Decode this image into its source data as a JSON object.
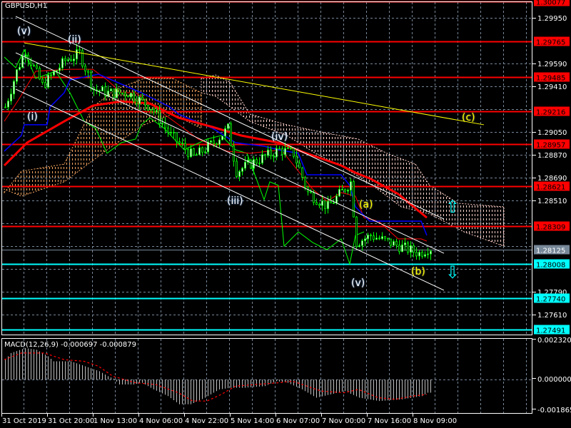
{
  "chart_data": {
    "type": "candlestick",
    "symbol_label": "GBPUSD,H1",
    "price_range": [
      1.2743,
      1.30091
    ],
    "price_ticks": [
      "1.29950",
      "1.29590",
      "1.29410",
      "1.29050",
      "1.28870",
      "1.28690",
      "1.28510",
      "1.27790",
      "1.27610"
    ],
    "time_labels": [
      "31 Oct 2019",
      "31 Oct 20:00",
      "1 Nov 13:00",
      "4 Nov 06:00",
      "4 Nov 22:00",
      "5 Nov 14:00",
      "6 Nov 07:00",
      "7 Nov 00:00",
      "7 Nov 16:00",
      "8 Nov 09:00"
    ],
    "bars": 150,
    "close_path": [
      [
        0,
        1.29247
      ],
      [
        4,
        1.29528
      ],
      [
        7,
        1.29697
      ],
      [
        13,
        1.29416
      ],
      [
        21,
        1.29613
      ],
      [
        26,
        1.29669
      ],
      [
        31,
        1.29387
      ],
      [
        36,
        1.29359
      ],
      [
        43,
        1.29359
      ],
      [
        51,
        1.29247
      ],
      [
        58,
        1.29022
      ],
      [
        66,
        1.28853
      ],
      [
        73,
        1.28966
      ],
      [
        78,
        1.29078
      ],
      [
        81,
        1.28741
      ],
      [
        88,
        1.28825
      ],
      [
        96,
        1.28909
      ],
      [
        101,
        1.28881
      ],
      [
        106,
        1.28572
      ],
      [
        113,
        1.28459
      ],
      [
        121,
        1.28656
      ],
      [
        123,
        1.28178
      ],
      [
        128,
        1.28234
      ],
      [
        138,
        1.2815
      ],
      [
        145,
        1.28094
      ],
      [
        148,
        1.28133
      ]
    ],
    "levels": [
      {
        "price": 1.30077,
        "label": "1.30077",
        "color": "#ff0000"
      },
      {
        "price": 1.29765,
        "label": "1.29765",
        "color": "#ff0000"
      },
      {
        "price": 1.29485,
        "label": "1.29485",
        "color": "#ff0000"
      },
      {
        "price": 1.29216,
        "label": "1.29216",
        "color": "#ff0000"
      },
      {
        "price": 1.28957,
        "label": "1.28957",
        "color": "#ff0000"
      },
      {
        "price": 1.28621,
        "label": "1.28621",
        "color": "#ff0000"
      },
      {
        "price": 1.28309,
        "label": "1.28309",
        "color": "#ff0000"
      },
      {
        "price": 1.28008,
        "label": "1.28008",
        "color": "#00ffff"
      },
      {
        "price": 1.2774,
        "label": "1.27740",
        "color": "#00ffff"
      },
      {
        "price": 1.27491,
        "label": "1.27491",
        "color": "#00ffff"
      }
    ],
    "current_price": {
      "price": 1.28125,
      "label": "1.28125",
      "color": "#778899"
    },
    "ma_red": [
      [
        0,
        1.28786
      ],
      [
        8,
        1.28966
      ],
      [
        21,
        1.29134
      ],
      [
        31,
        1.29258
      ],
      [
        41,
        1.29292
      ],
      [
        51,
        1.29275
      ],
      [
        61,
        1.29163
      ],
      [
        73,
        1.29089
      ],
      [
        83,
        1.29022
      ],
      [
        96,
        1.28966
      ],
      [
        106,
        1.28881
      ],
      [
        118,
        1.28786
      ],
      [
        123,
        1.28729
      ],
      [
        128,
        1.28684
      ],
      [
        138,
        1.28561
      ],
      [
        148,
        1.28375
      ]
    ],
    "tenkan_blue": [
      [
        0,
        1.28899
      ],
      [
        6,
        1.29022
      ],
      [
        7,
        1.29107
      ],
      [
        15,
        1.29107
      ],
      [
        16,
        1.29247
      ],
      [
        21,
        1.2936
      ],
      [
        23,
        1.29461
      ],
      [
        33,
        1.29506
      ],
      [
        48,
        1.2936
      ],
      [
        58,
        1.29247
      ],
      [
        61,
        1.29191
      ],
      [
        73,
        1.29079
      ],
      [
        81,
        1.28966
      ],
      [
        91,
        1.28938
      ],
      [
        96,
        1.2891
      ],
      [
        103,
        1.28882
      ],
      [
        106,
        1.28713
      ],
      [
        118,
        1.28713
      ],
      [
        121,
        1.28629
      ],
      [
        123,
        1.2846
      ],
      [
        128,
        1.28347
      ],
      [
        146,
        1.28347
      ],
      [
        148,
        1.28235
      ]
    ],
    "kijun_red": [
      [
        0,
        1.29135
      ],
      [
        5,
        1.29304
      ],
      [
        11,
        1.29529
      ],
      [
        23,
        1.29545
      ],
      [
        31,
        1.29545
      ],
      [
        36,
        1.29461
      ],
      [
        41,
        1.2936
      ],
      [
        46,
        1.2936
      ],
      [
        56,
        1.29191
      ],
      [
        68,
        1.28994
      ],
      [
        78,
        1.28899
      ],
      [
        86,
        1.28882
      ],
      [
        97,
        1.2891
      ],
      [
        103,
        1.28741
      ],
      [
        108,
        1.286
      ],
      [
        113,
        1.28505
      ],
      [
        118,
        1.28572
      ],
      [
        123,
        1.28544
      ],
      [
        126,
        1.28375
      ],
      [
        131,
        1.28347
      ],
      [
        138,
        1.28207
      ],
      [
        146,
        1.28207
      ],
      [
        148,
        1.2819
      ]
    ],
    "chikou_green": [
      [
        0,
        1.29641
      ],
      [
        4,
        1.29557
      ],
      [
        7,
        1.29697
      ],
      [
        11,
        1.29472
      ],
      [
        18,
        1.29529
      ],
      [
        23,
        1.2936
      ],
      [
        28,
        1.29135
      ],
      [
        32,
        1.29079
      ],
      [
        36,
        1.28882
      ],
      [
        41,
        1.28966
      ],
      [
        46,
        1.28994
      ],
      [
        48,
        1.29107
      ],
      [
        51,
        1.29163
      ],
      [
        56,
        1.29079
      ],
      [
        63,
        1.2891
      ],
      [
        71,
        1.28994
      ],
      [
        76,
        1.29022
      ],
      [
        81,
        1.2891
      ],
      [
        85,
        1.28882
      ],
      [
        91,
        1.28516
      ],
      [
        93,
        1.28657
      ],
      [
        96,
        1.28629
      ],
      [
        98,
        1.2815
      ],
      [
        103,
        1.28263
      ],
      [
        108,
        1.28179
      ],
      [
        113,
        1.28122
      ],
      [
        118,
        1.28207
      ],
      [
        121,
        1.2801
      ],
      [
        123,
        1.28235
      ],
      [
        126,
        1.28263
      ]
    ],
    "cloud_orange": {
      "top": [
        [
          0,
          1.28572
        ],
        [
          6,
          1.28741
        ],
        [
          21,
          1.28797
        ],
        [
          26,
          1.29022
        ],
        [
          31,
          1.29247
        ],
        [
          39,
          1.29388
        ],
        [
          49,
          1.29472
        ],
        [
          59,
          1.29472
        ],
        [
          69,
          1.2936
        ]
      ],
      "bottom": [
        [
          0,
          1.286
        ],
        [
          6,
          1.28544
        ],
        [
          21,
          1.28657
        ],
        [
          26,
          1.28741
        ],
        [
          36,
          1.2891
        ],
        [
          49,
          1.29107
        ],
        [
          59,
          1.29191
        ],
        [
          69,
          1.29079
        ]
      ],
      "color": "#f4a460"
    },
    "cloud_pink": {
      "top": [
        [
          69,
          1.29472
        ],
        [
          74,
          1.295
        ],
        [
          79,
          1.29444
        ],
        [
          86,
          1.29191
        ],
        [
          99,
          1.29107
        ],
        [
          111,
          1.2905
        ],
        [
          124,
          1.28994
        ],
        [
          134,
          1.28882
        ],
        [
          144,
          1.28797
        ],
        [
          149,
          1.28629
        ],
        [
          159,
          1.28488
        ],
        [
          175,
          1.2846
        ]
      ],
      "bottom": [
        [
          69,
          1.2936
        ],
        [
          74,
          1.29332
        ],
        [
          86,
          1.29135
        ],
        [
          99,
          1.29022
        ],
        [
          109,
          1.28882
        ],
        [
          119,
          1.28769
        ],
        [
          129,
          1.28629
        ],
        [
          139,
          1.2846
        ],
        [
          149,
          1.28404
        ],
        [
          161,
          1.28263
        ],
        [
          175,
          1.2815
        ]
      ],
      "color": "#ffd0c8"
    },
    "channel_lines": [
      {
        "from": [
          4,
          1.29962
        ],
        "to": [
          154,
          1.28364
        ]
      },
      {
        "from": [
          4,
          1.29675
        ],
        "to": [
          154,
          1.28094
        ]
      },
      {
        "from": [
          4,
          1.29388
        ],
        "to": [
          154,
          1.27802
        ]
      }
    ],
    "trend_line_yellow": {
      "from": [
        7,
        1.29753
      ],
      "to": [
        168,
        1.29107
      ]
    },
    "wave_labels": [
      "(v)",
      "(ii)",
      "(i)",
      "(iii)",
      "(iv)",
      "(a)",
      "(b)",
      "(v)",
      "(c)"
    ],
    "macd": {
      "title": "MACD(12,26,9) -0.000697 -0.000879",
      "ticks": [
        "0.002320",
        "0.000000",
        "-0.001865"
      ],
      "range": [
        -0.001865,
        0.00232
      ],
      "histogram": [
        [
          0,
          0.0012
        ],
        [
          2,
          0.0016
        ],
        [
          7,
          0.0019
        ],
        [
          11,
          0.0018
        ],
        [
          15,
          0.0014
        ],
        [
          17,
          0.0011
        ],
        [
          23,
          0.0011
        ],
        [
          28,
          0.0008
        ],
        [
          33,
          0.0005
        ],
        [
          36,
          0.0002
        ],
        [
          38,
          5e-05
        ],
        [
          40,
          -0.0003
        ],
        [
          45,
          -0.0003
        ],
        [
          48,
          -0.0002
        ],
        [
          52,
          -0.0006
        ],
        [
          57,
          -0.001
        ],
        [
          61,
          -0.0015
        ],
        [
          65,
          -0.0015
        ],
        [
          70,
          -0.0011
        ],
        [
          75,
          -0.0006
        ],
        [
          79,
          -0.0005
        ],
        [
          84,
          -0.0005
        ],
        [
          91,
          -0.0004
        ],
        [
          95,
          -0.0001
        ],
        [
          99,
          -0.0002
        ],
        [
          104,
          -0.0006
        ],
        [
          109,
          -0.0011
        ],
        [
          114,
          -0.0009
        ],
        [
          119,
          -0.0007
        ],
        [
          124,
          -0.0011
        ],
        [
          131,
          -0.0013
        ],
        [
          139,
          -0.0012
        ],
        [
          146,
          -0.001
        ],
        [
          148,
          -0.0008
        ]
      ],
      "signal": [
        [
          0,
          0.0012
        ],
        [
          6,
          0.0016
        ],
        [
          14,
          0.0016
        ],
        [
          21,
          0.0012
        ],
        [
          28,
          0.0011
        ],
        [
          33,
          0.0008
        ],
        [
          38,
          0.0002
        ],
        [
          46,
          -0.0002
        ],
        [
          53,
          -0.0003
        ],
        [
          61,
          -0.0008
        ],
        [
          66,
          -0.0013
        ],
        [
          71,
          -0.0013
        ],
        [
          76,
          -0.0009
        ],
        [
          81,
          -0.0004
        ],
        [
          88,
          -0.0003
        ],
        [
          96,
          -0.0002
        ],
        [
          101,
          -0.0001
        ],
        [
          106,
          -0.0004
        ],
        [
          111,
          -0.0007
        ],
        [
          119,
          -0.0008
        ],
        [
          124,
          -0.0006
        ],
        [
          131,
          -0.0011
        ],
        [
          137,
          -0.0012
        ],
        [
          143,
          -0.001
        ],
        [
          148,
          -0.0009
        ]
      ]
    }
  }
}
